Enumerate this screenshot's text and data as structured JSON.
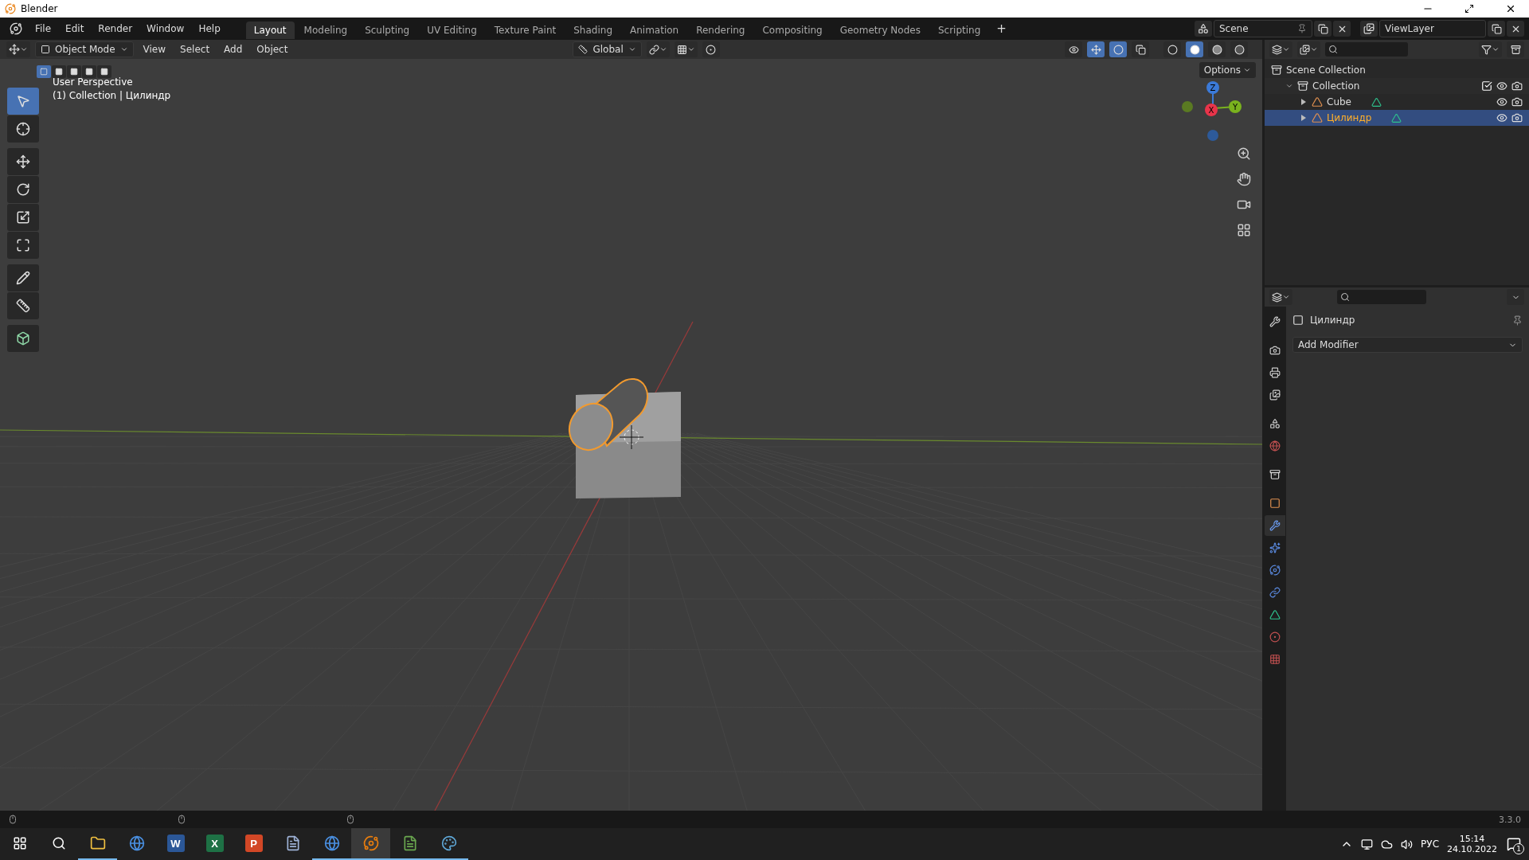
{
  "window": {
    "title": "Blender"
  },
  "menu": [
    "File",
    "Edit",
    "Render",
    "Window",
    "Help"
  ],
  "workspaces": [
    {
      "label": "Layout",
      "selected": true
    },
    {
      "label": "Modeling",
      "selected": false
    },
    {
      "label": "Sculpting",
      "selected": false
    },
    {
      "label": "UV Editing",
      "selected": false
    },
    {
      "label": "Texture Paint",
      "selected": false
    },
    {
      "label": "Shading",
      "selected": false
    },
    {
      "label": "Animation",
      "selected": false
    },
    {
      "label": "Rendering",
      "selected": false
    },
    {
      "label": "Compositing",
      "selected": false
    },
    {
      "label": "Geometry Nodes",
      "selected": false
    },
    {
      "label": "Scripting",
      "selected": false
    }
  ],
  "add_workspace": "+",
  "scene": "Scene",
  "view_layer": "ViewLayer",
  "viewport": {
    "mode": "Object Mode",
    "menus": [
      "View",
      "Select",
      "Add",
      "Object"
    ],
    "orientation": "Global",
    "options": "Options",
    "select_modes": [
      {
        "selected": true
      },
      {
        "selected": false
      },
      {
        "selected": false
      },
      {
        "selected": false
      },
      {
        "selected": false
      }
    ],
    "toggles": [
      {
        "kind": "visibility",
        "selected": false
      },
      {
        "kind": "gizmo",
        "selected": true
      },
      {
        "kind": "overlay",
        "selected": true
      },
      {
        "kind": "xray",
        "selected": false
      }
    ],
    "shading": [
      {
        "kind": "wireframe",
        "selected": false
      },
      {
        "kind": "solid",
        "selected": true
      },
      {
        "kind": "material",
        "selected": false
      },
      {
        "kind": "rendered",
        "selected": false
      }
    ],
    "overlay_text": [
      "User Perspective",
      "(1) Collection | Цилиндр"
    ],
    "tools": [
      {
        "kind": "select",
        "selected": true
      },
      {
        "kind": "cursor",
        "selected": false
      },
      {
        "kind": "move",
        "selected": false
      },
      {
        "kind": "rotate",
        "selected": false
      },
      {
        "kind": "scale",
        "selected": false
      },
      {
        "kind": "transform",
        "selected": false
      },
      {
        "kind": "annotate",
        "selected": false
      },
      {
        "kind": "measure",
        "selected": false
      },
      {
        "kind": "add-cube",
        "selected": false
      }
    ],
    "axes": [
      "Z",
      "X",
      "Y"
    ]
  },
  "outliner": {
    "items": [
      {
        "label": "Scene Collection",
        "kind": "scene",
        "selected": false,
        "children": [
          {
            "label": "Collection",
            "kind": "collection",
            "selected": false,
            "expanded": true,
            "checked": true,
            "children": [
              {
                "label": "Cube",
                "kind": "mesh",
                "selected": false,
                "expanded": false
              },
              {
                "label": "Цилиндр",
                "kind": "mesh",
                "selected": true,
                "expanded": false
              }
            ]
          }
        ]
      }
    ]
  },
  "properties": {
    "object_name": "Цилиндр",
    "add_modifier": "Add Modifier",
    "tabs": [
      {
        "kind": "tool",
        "selected": false
      },
      {
        "kind": "render",
        "selected": false
      },
      {
        "kind": "output",
        "selected": false
      },
      {
        "kind": "view-layer",
        "selected": false
      },
      {
        "kind": "scene",
        "selected": false
      },
      {
        "kind": "world",
        "selected": false
      },
      {
        "kind": "collection",
        "selected": false
      },
      {
        "kind": "object",
        "selected": false
      },
      {
        "kind": "modifiers",
        "selected": true
      },
      {
        "kind": "particles",
        "selected": false
      },
      {
        "kind": "physics",
        "selected": false
      },
      {
        "kind": "constraints",
        "selected": false
      },
      {
        "kind": "data",
        "selected": false
      },
      {
        "kind": "material",
        "selected": false
      },
      {
        "kind": "texture",
        "selected": false
      }
    ]
  },
  "status_bar": {
    "version": "3.3.0"
  },
  "taskbar": {
    "apps": [
      {
        "kind": "explorer",
        "running": true,
        "selected": false
      },
      {
        "kind": "chrome",
        "running": false,
        "selected": false
      },
      {
        "kind": "word",
        "glyph": "W",
        "running": false,
        "selected": false
      },
      {
        "kind": "excel",
        "glyph": "X",
        "running": false,
        "selected": false
      },
      {
        "kind": "powerpoint",
        "glyph": "P",
        "running": false,
        "selected": false
      },
      {
        "kind": "document",
        "running": false,
        "selected": false
      },
      {
        "kind": "chrome",
        "running": true,
        "selected": false
      },
      {
        "kind": "blender",
        "running": true,
        "selected": true
      },
      {
        "kind": "notepad",
        "running": true,
        "selected": false
      },
      {
        "kind": "paint",
        "running": true,
        "selected": false
      }
    ],
    "language": "РУС",
    "time": "15:14",
    "date": "24.10.2022",
    "notifications": "1"
  }
}
